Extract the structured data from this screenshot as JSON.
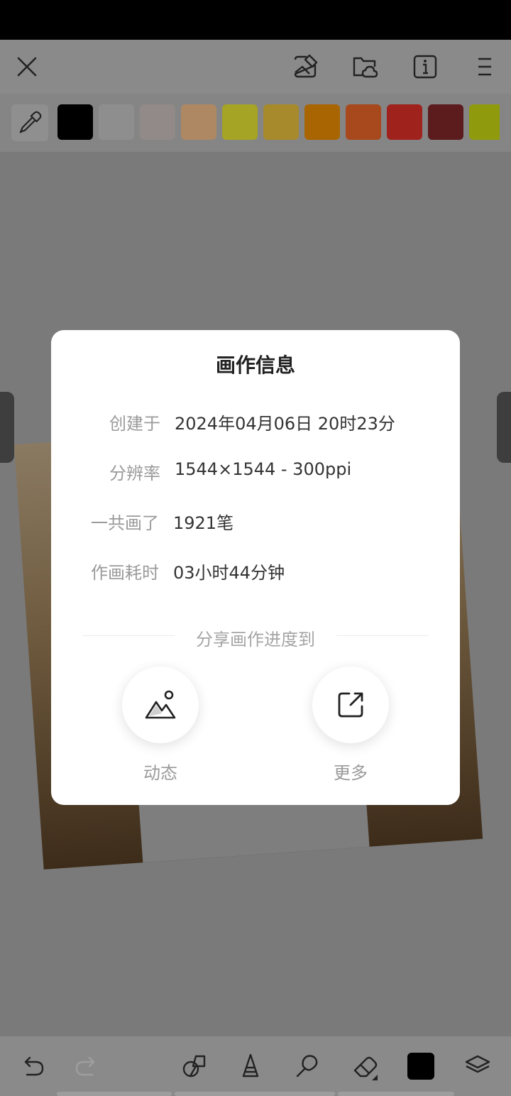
{
  "toolbar": {
    "icons": [
      "close-icon",
      "canvas-settings-icon",
      "cloud-folder-icon",
      "info-icon",
      "menu-icon"
    ]
  },
  "palette": {
    "tool": "eyedropper-icon",
    "colors": [
      "#000000",
      "#8e8e8e",
      "#918a89",
      "#ad8862",
      "#a5a424",
      "#a78a2b",
      "#a96502",
      "#a8491d",
      "#a0221d",
      "#5c1b1d",
      "#8f9b0c"
    ]
  },
  "dialog": {
    "title": "画作信息",
    "rows": [
      {
        "label": "创建于",
        "value": "2024年04月06日 20时23分"
      },
      {
        "label": "分辨率",
        "value": "1544×1544 - 300ppi"
      },
      {
        "label": "一共画了",
        "value": "1921笔"
      },
      {
        "label": "作画耗时",
        "value": "03小时44分钟"
      }
    ],
    "share_heading": "分享画作进度到",
    "share_options": [
      {
        "label": "动态",
        "icon": "mountain-image-icon"
      },
      {
        "label": "更多",
        "icon": "external-share-icon"
      }
    ]
  },
  "bottom_toolbar": {
    "icons": [
      "undo-icon",
      "redo-icon",
      "shapes-icon",
      "brush-tool-icon",
      "smudge-tool-icon",
      "eraser-icon",
      "current-color-icon",
      "layers-icon"
    ],
    "current_color": "#000000"
  }
}
